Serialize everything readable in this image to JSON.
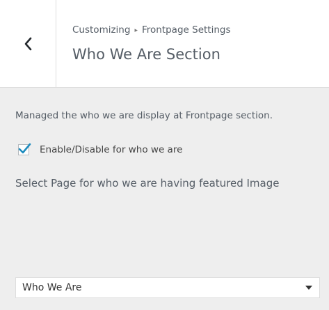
{
  "header": {
    "breadcrumb_root": "Customizing",
    "breadcrumb_separator": "▸",
    "breadcrumb_parent": "Frontpage Settings",
    "title": "Who We Are Section",
    "back_icon": "chevron-left-icon"
  },
  "section": {
    "description": "Managed the who we are display at Frontpage section.",
    "toggle": {
      "label": "Enable/Disable for who we are",
      "checked": true,
      "check_color": "#1e8cbe"
    },
    "page_select": {
      "label": "Select Page for who we are having featured Image",
      "selected": "Who We Are",
      "arrow_icon": "triangle-down-icon"
    }
  }
}
